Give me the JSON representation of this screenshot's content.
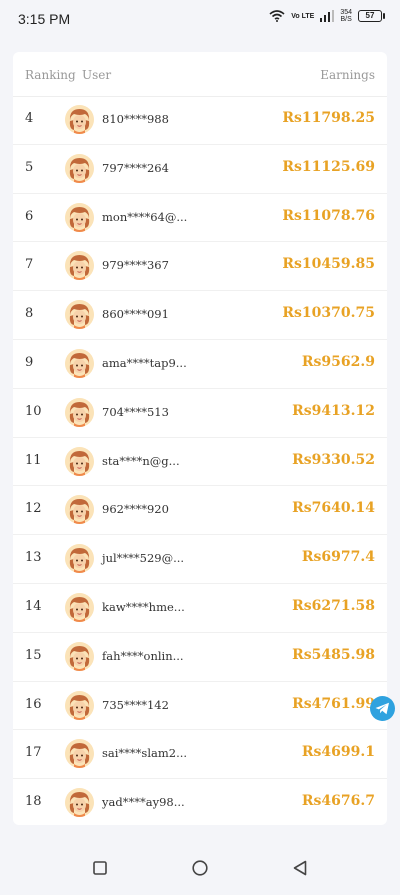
{
  "status_bar": {
    "time": "3:15 PM",
    "network_label": "Vo LTE",
    "speed_value": "354",
    "speed_unit": "B/S",
    "battery": "57"
  },
  "table": {
    "headers": {
      "ranking": "Ranking",
      "user": "User",
      "earnings": "Earnings"
    },
    "rows": [
      {
        "rank": "4",
        "user": "810****988",
        "earnings": "Rs11798.25"
      },
      {
        "rank": "5",
        "user": "797****264",
        "earnings": "Rs11125.69"
      },
      {
        "rank": "6",
        "user": "mon****64@...",
        "earnings": "Rs11078.76"
      },
      {
        "rank": "7",
        "user": "979****367",
        "earnings": "Rs10459.85"
      },
      {
        "rank": "8",
        "user": "860****091",
        "earnings": "Rs10370.75"
      },
      {
        "rank": "9",
        "user": "ama****tap9...",
        "earnings": "Rs9562.9"
      },
      {
        "rank": "10",
        "user": "704****513",
        "earnings": "Rs9413.12"
      },
      {
        "rank": "11",
        "user": "sta****n@g...",
        "earnings": "Rs9330.52"
      },
      {
        "rank": "12",
        "user": "962****920",
        "earnings": "Rs7640.14"
      },
      {
        "rank": "13",
        "user": "jul****529@...",
        "earnings": "Rs6977.4"
      },
      {
        "rank": "14",
        "user": "kaw****hme...",
        "earnings": "Rs6271.58"
      },
      {
        "rank": "15",
        "user": "fah****onlin...",
        "earnings": "Rs5485.98"
      },
      {
        "rank": "16",
        "user": "735****142",
        "earnings": "Rs4761.99"
      },
      {
        "rank": "17",
        "user": "sai****slam2...",
        "earnings": "Rs4699.1"
      },
      {
        "rank": "18",
        "user": "yad****ay98...",
        "earnings": "Rs4676.7"
      }
    ]
  },
  "icons": {
    "avatar": "cartoon-avatar-icon",
    "telegram": "telegram-icon",
    "nav_recent": "square-icon",
    "nav_home": "circle-icon",
    "nav_back": "triangle-back-icon"
  },
  "colors": {
    "earnings": "#e8a224",
    "telegram": "#2fa2df",
    "background": "#f4f5f9"
  }
}
